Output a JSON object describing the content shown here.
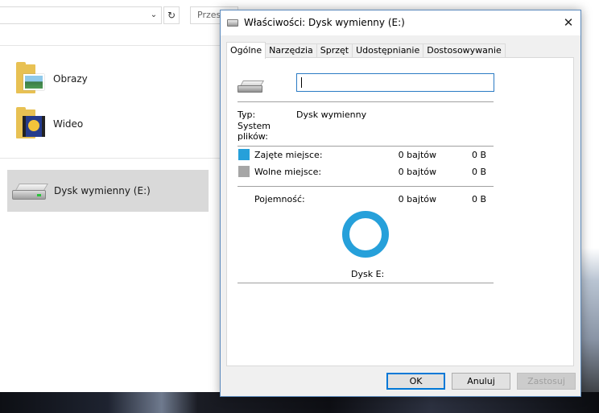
{
  "explorer": {
    "address_dropdown_glyph": "⌄",
    "refresh_glyph": "↻",
    "search_placeholder": "Przes",
    "items": [
      {
        "label": "Obrazy",
        "icon": "pictures-folder-icon"
      },
      {
        "label": "Wideo",
        "icon": "videos-folder-icon"
      }
    ],
    "drive": {
      "label": "Dysk wymienny (E:)",
      "icon": "removable-drive-icon",
      "selected": true
    }
  },
  "dialog": {
    "title": "Właściwości: Dysk wymienny (E:)",
    "close_glyph": "✕",
    "tabs": [
      {
        "label": "Ogólne",
        "active": true
      },
      {
        "label": "Narzędzia",
        "active": false
      },
      {
        "label": "Sprzęt",
        "active": false
      },
      {
        "label": "Udostępnianie",
        "active": false
      },
      {
        "label": "Dostosowywanie",
        "active": false
      }
    ],
    "general": {
      "name_value": "",
      "type_label": "Typ:",
      "type_value": "Dysk wymienny",
      "fs_label_line1": "System",
      "fs_label_line2": "plików:",
      "fs_value": "",
      "used": {
        "label": "Zajęte miejsce:",
        "bytes": "0 bajtów",
        "size": "0 B",
        "color": "#26a0da"
      },
      "free": {
        "label": "Wolne miejsce:",
        "bytes": "0 bajtów",
        "size": "0 B",
        "color": "#a6a6a6"
      },
      "capacity": {
        "label": "Pojemność:",
        "bytes": "0 bajtów",
        "size": "0 B"
      },
      "used_fraction": 0,
      "drive_caption": "Dysk E:"
    },
    "buttons": {
      "ok": "OK",
      "cancel": "Anuluj",
      "apply": "Zastosuj"
    }
  }
}
